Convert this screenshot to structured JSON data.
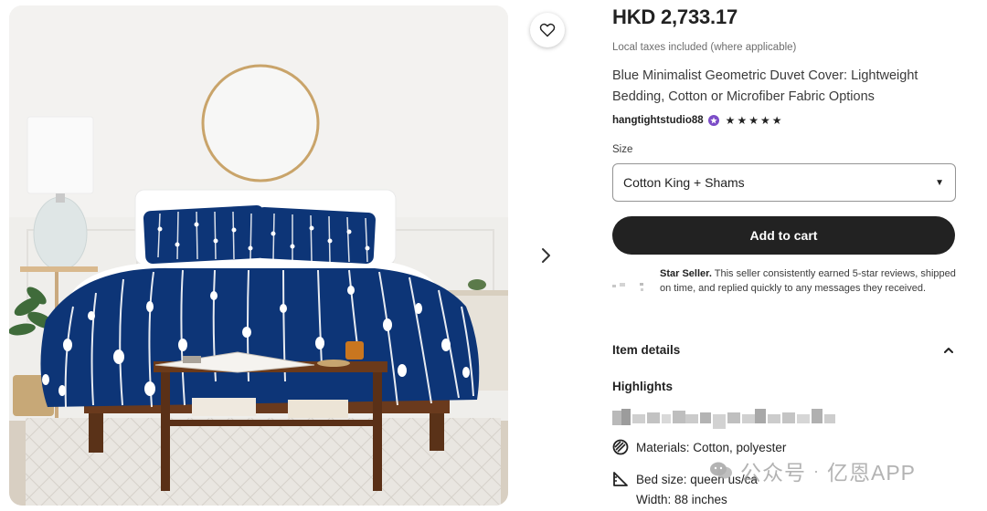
{
  "listing": {
    "price": "HKD 2,733.17",
    "tax_note": "Local taxes included (where applicable)",
    "title": "Blue Minimalist Geometric Duvet Cover: Lightweight Bedding, Cotton or Microfiber Fabric Options",
    "seller_name": "hangtightstudio88",
    "rating_stars": 5
  },
  "size": {
    "label": "Size",
    "selected": "Cotton King + Shams"
  },
  "cart": {
    "button_label": "Add to cart"
  },
  "star_seller": {
    "title": "Star Seller.",
    "text": "This seller consistently earned 5-star reviews, shipped on time, and replied quickly to any messages they received."
  },
  "item_details": {
    "heading": "Item details",
    "highlights_heading": "Highlights",
    "materials": "Materials: Cotton, polyester",
    "bed_size": "Bed size: queen us/ca",
    "width": "Width: 88 inches"
  },
  "watermark": {
    "channel": "公众号",
    "name": "亿恩APP"
  },
  "icons": {
    "favorite": "heart-outline-icon",
    "next": "chevron-right-icon",
    "caret": "caret-down-icon",
    "collapse": "chevron-up-icon",
    "materials": "fabric-icon",
    "bed_size": "ruler-triangle-icon",
    "seller_badge": "star-badge-icon"
  },
  "colors": {
    "button_bg": "#222222",
    "seller_badge": "#7b4cc7",
    "duvet_navy": "#0d3577"
  }
}
